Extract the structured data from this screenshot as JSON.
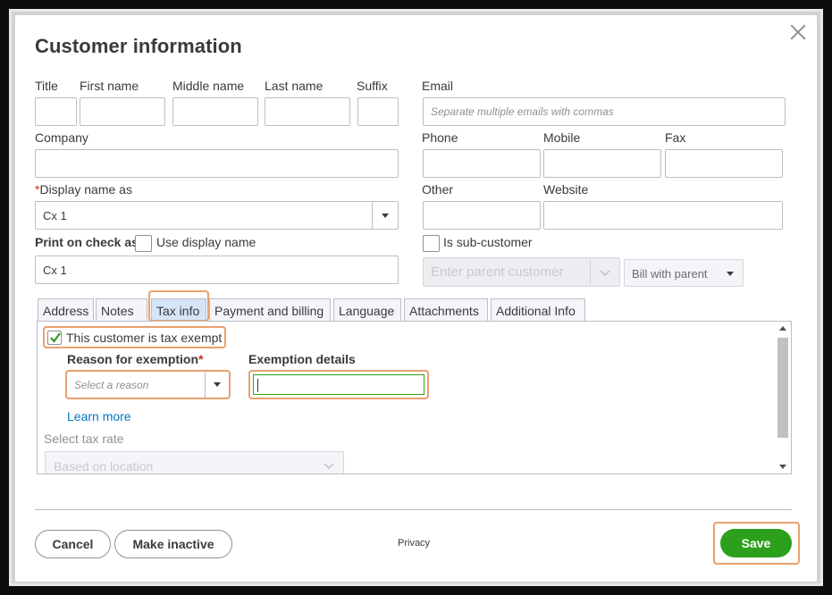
{
  "dialog": {
    "title": "Customer information"
  },
  "name_fields": {
    "title_label": "Title",
    "first_name_label": "First name",
    "middle_name_label": "Middle name",
    "last_name_label": "Last name",
    "suffix_label": "Suffix",
    "title_value": "",
    "first_name_value": "",
    "middle_name_value": "",
    "last_name_value": "",
    "suffix_value": ""
  },
  "email": {
    "label": "Email",
    "placeholder": "Separate multiple emails with commas",
    "value": ""
  },
  "company": {
    "label": "Company",
    "value": ""
  },
  "contact": {
    "phone_label": "Phone",
    "mobile_label": "Mobile",
    "fax_label": "Fax",
    "other_label": "Other",
    "website_label": "Website"
  },
  "display_name": {
    "required_mark": "*",
    "label": "Display name as",
    "value": "Cx 1"
  },
  "print_on_check": {
    "label": "Print on check as",
    "use_display_name_label": "Use display name",
    "use_display_name_checked": false,
    "value": "Cx 1"
  },
  "sub_customer": {
    "label": "Is sub-customer",
    "checked": false,
    "parent_placeholder": "Enter parent customer",
    "bill_with_label": "Bill with parent"
  },
  "tabs": [
    {
      "label": "Address",
      "active": false
    },
    {
      "label": "Notes",
      "active": false
    },
    {
      "label": "Tax info",
      "active": true
    },
    {
      "label": "Payment and billing",
      "active": false
    },
    {
      "label": "Language",
      "active": false
    },
    {
      "label": "Attachments",
      "active": false
    },
    {
      "label": "Additional Info",
      "active": false
    }
  ],
  "tax_info": {
    "tax_exempt_label": "This customer is tax exempt",
    "tax_exempt_checked": true,
    "reason_label": "Reason for exemption",
    "reason_required_mark": "*",
    "reason_placeholder": "Select a reason",
    "exemption_details_label": "Exemption details",
    "exemption_details_value": "",
    "learn_more": "Learn more",
    "select_tax_rate_label": "Select tax rate",
    "tax_rate_value": "Based on location"
  },
  "footer": {
    "cancel": "Cancel",
    "make_inactive": "Make inactive",
    "privacy": "Privacy",
    "save": "Save"
  },
  "colors": {
    "accent_green": "#2ca01c",
    "link_blue": "#0077c5",
    "highlight_orange": "#e9a06d",
    "active_tab": "#d4e5f7",
    "required_red": "#d52b1e"
  }
}
